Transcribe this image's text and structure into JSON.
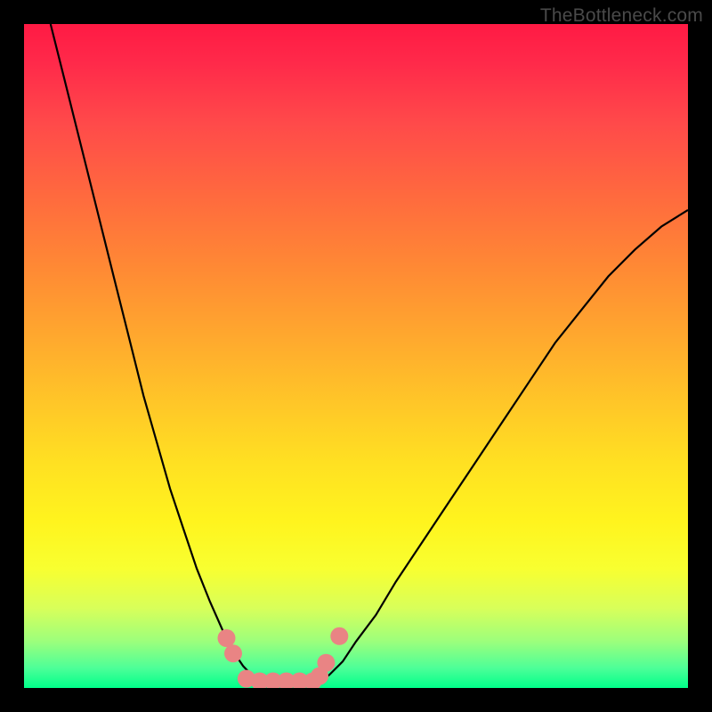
{
  "watermark": "TheBottleneck.com",
  "colors": {
    "page_bg": "#000000",
    "curve_stroke": "#000000",
    "marker_fill": "#e98484",
    "gradient_top": "#ff1a44",
    "gradient_bottom": "#00ff8a"
  },
  "chart_data": {
    "type": "line",
    "title": "",
    "xlabel": "",
    "ylabel": "",
    "xlim": [
      0,
      100
    ],
    "ylim": [
      0,
      100
    ],
    "grid": false,
    "legend": false,
    "note": "No axes or tick labels are rendered; x and y are normalized 0–100 percentages of the plot area (x left→right, y bottom→top). Values estimated from pixel positions.",
    "series": [
      {
        "name": "left_branch",
        "x": [
          4,
          6,
          8,
          10,
          12,
          14,
          16,
          18,
          20,
          22,
          24,
          26,
          28,
          30,
          31.5,
          33,
          34.5,
          36
        ],
        "y": [
          100,
          92,
          84,
          76,
          68,
          60,
          52,
          44,
          37,
          30,
          24,
          18,
          13,
          8.5,
          5.5,
          3.3,
          1.7,
          0.5
        ]
      },
      {
        "name": "right_branch",
        "x": [
          44,
          46,
          48,
          50,
          53,
          56,
          60,
          64,
          68,
          72,
          76,
          80,
          84,
          88,
          92,
          96,
          100
        ],
        "y": [
          0.5,
          2,
          4,
          7,
          11,
          16,
          22,
          28,
          34,
          40,
          46,
          52,
          57,
          62,
          66,
          69.5,
          72
        ]
      },
      {
        "name": "bottom_markers",
        "style": "scatter",
        "x": [
          30.5,
          31.5,
          33.5,
          35.5,
          37.5,
          39.5,
          41.5,
          43.5,
          44.5,
          45.5,
          47.5
        ],
        "y": [
          7.5,
          5.2,
          1.4,
          1.0,
          1.0,
          1.0,
          1.0,
          1.0,
          1.8,
          3.8,
          7.8
        ]
      }
    ]
  }
}
